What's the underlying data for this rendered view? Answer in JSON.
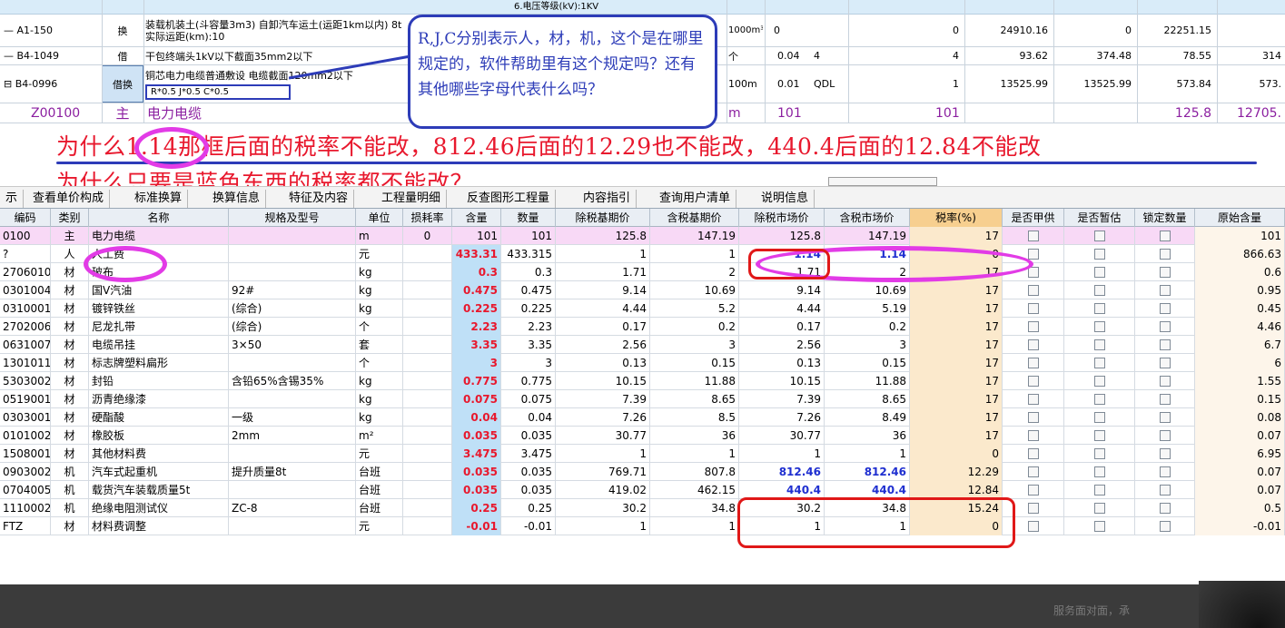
{
  "top": {
    "header_strip": "6.电压等级(kV):1KV",
    "rows": [
      {
        "code": "— A1-150",
        "type": "换",
        "name": "装载机装土(斗容量3m3) 自卸汽车运土(运距1km以内) 8t  实际运距(km):10",
        "unit": "1000m³",
        "qty": "0",
        "v1": "0",
        "v2": "24910.16",
        "v3": "0",
        "v4": "22251.15",
        "v5": ""
      },
      {
        "code": "— B4-1049",
        "type": "借",
        "name": "干包终端头1kV以下截面35mm2以下",
        "unit": "个",
        "qty": "0.04",
        "extra": "4",
        "v1": "4",
        "v2": "93.62",
        "v3": "374.48",
        "v4": "78.55",
        "v5": "314"
      },
      {
        "code": "⊟ B4-0996",
        "type": "借换",
        "name": "铜芯电力电缆普通敷设 电缆截面120mm2以下",
        "formula": "R*0.5 J*0.5  C*0.5",
        "unit": "100m",
        "qty": "0.01",
        "extra": "QDL",
        "v1": "1",
        "v2": "13525.99",
        "v3": "13525.99",
        "v4": "573.84",
        "v5": "573."
      },
      {
        "code": "Z00100",
        "type": "主",
        "name": "电力电缆",
        "unit": "m",
        "qty": "101",
        "v1": "101",
        "v2": "",
        "v3": "",
        "v4": "125.8",
        "v5": "12705."
      }
    ]
  },
  "callout": {
    "text": "R,J,C分别表示人，材，机，这个是在哪里规定的，软件帮助里有这个规定吗？还有其他哪些字母代表什么吗？"
  },
  "question": {
    "line1": "为什么1.14那框后面的税率不能改，812.46后面的12.29也不能改，440.4后面的12.84不能改",
    "line2": "为什么只要是蓝色东西的税率都不能改？"
  },
  "tabs": [
    "示",
    "查看单价构成",
    "标准换算",
    "换算信息",
    "特征及内容",
    "工程量明细",
    "反查图形工程量",
    "内容指引",
    "查询用户清单",
    "说明信息"
  ],
  "grid": {
    "headers": [
      "编码",
      "类别",
      "名称",
      "规格及型号",
      "单位",
      "损耗率",
      "含量",
      "数量",
      "除税基期价",
      "含税基期价",
      "除税市场价",
      "含税市场价",
      "税率(%)",
      "是否甲供",
      "是否暂估",
      "锁定数量",
      "原始含量"
    ],
    "rows": [
      {
        "code": "0100",
        "cat": "主",
        "name": "电力电缆",
        "spec": "",
        "unit": "m",
        "loss": "0",
        "amt": "101",
        "qty": "101",
        "p1": "125.8",
        "p2": "147.19",
        "p3": "125.8",
        "p4": "147.19",
        "tax": "17",
        "orig": "101",
        "main": true
      },
      {
        "code": "?",
        "cat": "人",
        "name": "人工费",
        "spec": "",
        "unit": "元",
        "loss": "",
        "amt": "433.31",
        "qty": "433.315",
        "p1": "1",
        "p2": "1",
        "p3": "1.14",
        "p4": "1.14",
        "tax": "0",
        "orig": "866.63",
        "blue": true
      },
      {
        "code": "2706010",
        "cat": "材",
        "name": "破布",
        "spec": "",
        "unit": "kg",
        "loss": "",
        "amt": "0.3",
        "qty": "0.3",
        "p1": "1.71",
        "p2": "2",
        "p3": "1.71",
        "p4": "2",
        "tax": "17",
        "orig": "0.6"
      },
      {
        "code": "0301004",
        "cat": "材",
        "name": "国V汽油",
        "spec": "92#",
        "unit": "kg",
        "loss": "",
        "amt": "0.475",
        "qty": "0.475",
        "p1": "9.14",
        "p2": "10.69",
        "p3": "9.14",
        "p4": "10.69",
        "tax": "17",
        "orig": "0.95"
      },
      {
        "code": "0310001",
        "cat": "材",
        "name": "镀锌铁丝",
        "spec": "(综合)",
        "unit": "kg",
        "loss": "",
        "amt": "0.225",
        "qty": "0.225",
        "p1": "4.44",
        "p2": "5.2",
        "p3": "4.44",
        "p4": "5.19",
        "tax": "17",
        "orig": "0.45"
      },
      {
        "code": "2702006",
        "cat": "材",
        "name": "尼龙扎带",
        "spec": "(综合)",
        "unit": "个",
        "loss": "",
        "amt": "2.23",
        "qty": "2.23",
        "p1": "0.17",
        "p2": "0.2",
        "p3": "0.17",
        "p4": "0.2",
        "tax": "17",
        "orig": "4.46"
      },
      {
        "code": "0631007",
        "cat": "材",
        "name": "电缆吊挂",
        "spec": "3×50",
        "unit": "套",
        "loss": "",
        "amt": "3.35",
        "qty": "3.35",
        "p1": "2.56",
        "p2": "3",
        "p3": "2.56",
        "p4": "3",
        "tax": "17",
        "orig": "6.7"
      },
      {
        "code": "1301011",
        "cat": "材",
        "name": "标志牌塑料扁形",
        "spec": "",
        "unit": "个",
        "loss": "",
        "amt": "3",
        "qty": "3",
        "p1": "0.13",
        "p2": "0.15",
        "p3": "0.13",
        "p4": "0.15",
        "tax": "17",
        "orig": "6"
      },
      {
        "code": "5303002",
        "cat": "材",
        "name": "封铅",
        "spec": "含铅65%含锡35%",
        "unit": "kg",
        "loss": "",
        "amt": "0.775",
        "qty": "0.775",
        "p1": "10.15",
        "p2": "11.88",
        "p3": "10.15",
        "p4": "11.88",
        "tax": "17",
        "orig": "1.55"
      },
      {
        "code": "0519001",
        "cat": "材",
        "name": "沥青绝缘漆",
        "spec": "",
        "unit": "kg",
        "loss": "",
        "amt": "0.075",
        "qty": "0.075",
        "p1": "7.39",
        "p2": "8.65",
        "p3": "7.39",
        "p4": "8.65",
        "tax": "17",
        "orig": "0.15"
      },
      {
        "code": "0303001",
        "cat": "材",
        "name": "硬酯酸",
        "spec": "一级",
        "unit": "kg",
        "loss": "",
        "amt": "0.04",
        "qty": "0.04",
        "p1": "7.26",
        "p2": "8.5",
        "p3": "7.26",
        "p4": "8.49",
        "tax": "17",
        "orig": "0.08"
      },
      {
        "code": "0101002",
        "cat": "材",
        "name": "橡胶板",
        "spec": "2mm",
        "unit": "m²",
        "loss": "",
        "amt": "0.035",
        "qty": "0.035",
        "p1": "30.77",
        "p2": "36",
        "p3": "30.77",
        "p4": "36",
        "tax": "17",
        "orig": "0.07"
      },
      {
        "code": "1508001",
        "cat": "材",
        "name": "其他材料费",
        "spec": "",
        "unit": "元",
        "loss": "",
        "amt": "3.475",
        "qty": "3.475",
        "p1": "1",
        "p2": "1",
        "p3": "1",
        "p4": "1",
        "tax": "0",
        "orig": "6.95"
      },
      {
        "code": "0903002",
        "cat": "机",
        "name": "汽车式起重机",
        "spec": "提升质量8t",
        "unit": "台班",
        "loss": "",
        "amt": "0.035",
        "qty": "0.035",
        "p1": "769.71",
        "p2": "807.8",
        "p3": "812.46",
        "p4": "812.46",
        "tax": "12.29",
        "orig": "0.07",
        "blue": true
      },
      {
        "code": "0704005",
        "cat": "机",
        "name": "载货汽车装载质量5t",
        "spec": "",
        "unit": "台班",
        "loss": "",
        "amt": "0.035",
        "qty": "0.035",
        "p1": "419.02",
        "p2": "462.15",
        "p3": "440.4",
        "p4": "440.4",
        "tax": "12.84",
        "orig": "0.07",
        "blue": true
      },
      {
        "code": "1110002",
        "cat": "机",
        "name": "绝缘电阻测试仪",
        "spec": "ZC-8",
        "unit": "台班",
        "loss": "",
        "amt": "0.25",
        "qty": "0.25",
        "p1": "30.2",
        "p2": "34.8",
        "p3": "30.2",
        "p4": "34.8",
        "tax": "15.24",
        "orig": "0.5"
      },
      {
        "code": "FTZ",
        "cat": "材",
        "name": "材料费调整",
        "spec": "",
        "unit": "元",
        "loss": "",
        "amt": "-0.01",
        "qty": "-0.01",
        "p1": "1",
        "p2": "1",
        "p3": "1",
        "p4": "1",
        "tax": "0",
        "orig": "-0.01"
      }
    ]
  },
  "footer": {
    "hint": "服务面对面，承"
  },
  "colors": {
    "annotation_red": "#e8182d",
    "annotation_blue": "#2d3cb8",
    "oval_magenta": "#e23be6",
    "box_red": "#e01818",
    "tax_header": "#f7cf8f",
    "amt_cell": "#bfe0f7"
  }
}
